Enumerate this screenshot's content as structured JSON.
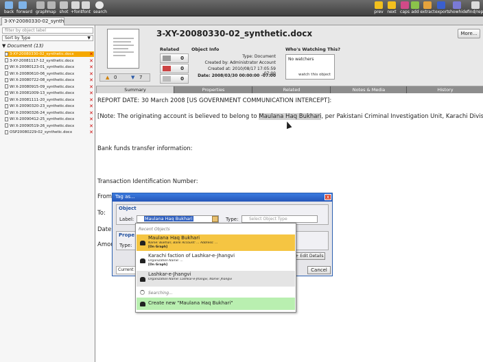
{
  "toolbar": {
    "left": [
      {
        "label": "back",
        "color": "#7fb3e8"
      },
      {
        "label": "forward",
        "color": "#7fb3e8"
      },
      {
        "label": "graph",
        "color": "#b5b5b5"
      },
      {
        "label": "map",
        "color": "#b5b5b5"
      },
      {
        "label": "shot",
        "color": "#c4c4c4"
      },
      {
        "label": "+font",
        "color": "#d9d9d9"
      },
      {
        "label": "-font",
        "color": "#d9d9d9"
      },
      {
        "label": "search",
        "color": "#e8e8e8"
      }
    ],
    "right": [
      {
        "label": "prev",
        "color": "#f2c01e"
      },
      {
        "label": "next",
        "color": "#f2c01e"
      },
      {
        "label": "caps",
        "color": "#d14a88"
      },
      {
        "label": "add",
        "color": "#8bc34a"
      },
      {
        "label": "extract",
        "color": "#e6a23c"
      },
      {
        "label": "export",
        "color": "#3a5fcd"
      },
      {
        "label": "showhide",
        "color": "#7a7ad6"
      },
      {
        "label": "find/rep",
        "color": "#dcdcdc"
      }
    ]
  },
  "tab": {
    "label": "3-XY-20080330-02_synth..."
  },
  "sidebar": {
    "filter_placeholder": "filter by object label",
    "sort_label": "Sort by Type",
    "group": "Document (13)",
    "documents": [
      {
        "label": "3-XY-20080330-02_synthetic.docx",
        "selected": true
      },
      {
        "label": "3-XY-20081117-12_synthetic.docx"
      },
      {
        "label": "WI X-20080123-01_synthetic.docx"
      },
      {
        "label": "WI X-20080610-06_synthetic.docx"
      },
      {
        "label": "WI X-20080722-08_synthetic.docx"
      },
      {
        "label": "WI X-20080915-09_synthetic.docx"
      },
      {
        "label": "WI X-20081009-13_synthetic.docx"
      },
      {
        "label": "WI X-20081111-20_synthetic.docx"
      },
      {
        "label": "WI X-20090320-23_synthetic.docx"
      },
      {
        "label": "WI X-20090326-24_synthetic.docx"
      },
      {
        "label": "WI X-20090412-25_synthetic.docx"
      },
      {
        "label": "WI X-20090519-26_synthetic.docx"
      },
      {
        "label": "OSP20080229-02_synthetic.docx"
      }
    ]
  },
  "header": {
    "title": "3-XY-20080330-02_synthetic.docx",
    "more_label": "More...",
    "related_label": "Related",
    "related_counts": [
      "0",
      "0",
      "0"
    ],
    "object_info_label": "Object Info",
    "object_info": [
      "Type: Document",
      "Created by: Administrator Account",
      "Created at: 2010/08/17 17:05:59 -07:00",
      "Date: 2008/03/30 00:00:00 -07:00"
    ],
    "watching_label": "Who's Watching This?",
    "no_watchers": "No watchers",
    "watch_link": "watch this object",
    "votes_up": "0",
    "votes_down": "7"
  },
  "subtabs": [
    "Summary",
    "Properties",
    "Related",
    "Notes & Media",
    "History"
  ],
  "content": {
    "line1": "REPORT DATE:   30 March 2008 [US GOVERNMENT COMMUNICATION INTERCEPT]:",
    "line2_pre": "[Note: The originating account is believed to belong to ",
    "line2_hl": "Maulana Haq Bukhari",
    "line2_post": ", per Pakistani Criminal Investigation Unit, Karachi Division]",
    "line3": "Bank funds transfer information:",
    "line4": "Transaction Identification Number:",
    "from": "From",
    "to": "To:",
    "date": "Date",
    "amount": "Amou"
  },
  "dialog": {
    "title": "Tag as...",
    "close": "X",
    "object_legend": "Object",
    "label_label": "Label:",
    "label_value": "Maulana Haq Bukhari",
    "type_label": "Type:",
    "type_placeholder": "Select Object Type",
    "properties_legend": "Prope",
    "prop_type_label": "Type:",
    "edit_details": "+ Edit Details",
    "current_sel": "Current se",
    "cancel": "Cancel"
  },
  "dropdown": {
    "recent_header": "Recent Objects",
    "items": [
      {
        "name": "Maulana Haq Bukhari",
        "detail": "Name: Bukhari, Bank Account: ... Address: ...",
        "on_graph": "[On Graph]",
        "highlight": "#f5c542"
      },
      {
        "name": "Karachi faction of Lashkar-e-Jhangvi",
        "detail": "Organization Name: ...",
        "on_graph": "[On Graph]",
        "highlight": ""
      },
      {
        "name": "Lashkar-e-Jhangvi",
        "detail": "Organization Name: Lashkar-e-Jhangvi, Name: Jhangvi",
        "on_graph": "",
        "highlight": "#e4e4e4"
      }
    ],
    "searching": "Searching...",
    "create_new": "Create new \"Maulana Haq Bukhari\""
  }
}
